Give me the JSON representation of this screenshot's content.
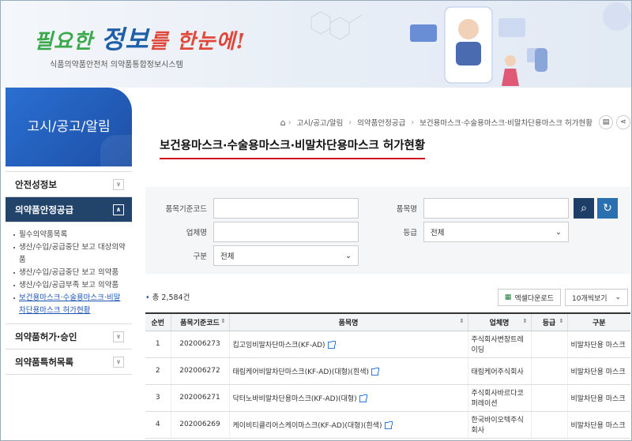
{
  "header": {
    "slogan_part1": "필요한",
    "slogan_part2": "정보",
    "slogan_part3": "를 한눈에!",
    "subtitle": "식품의약품안전처 의약품통합정보시스템"
  },
  "sidebar": {
    "title": "고시/공고/알림",
    "menu": [
      {
        "label": "안전성정보",
        "active": false
      },
      {
        "label": "의약품안정공급",
        "active": true
      },
      {
        "label": "의약품허가·승인",
        "active": false
      },
      {
        "label": "의약품특허목록",
        "active": false
      }
    ],
    "submenu": [
      "필수의약품목록",
      "생산/수입/공급중단 보고 대상의약품",
      "생산/수입/공급중단 보고 의약품",
      "생산/수입/공급부족 보고 의약품",
      "보건용마스크·수술용마스크·비말차단용마스크 허가현황"
    ]
  },
  "breadcrumb": [
    "고시/공고/알림",
    "의약품안정공급",
    "보건용마스크·수술용마스크·비말차단용마스크 허가현황"
  ],
  "page_title": "보건용마스크·수술용마스크·비말차단용마스크 허가현황",
  "search": {
    "code_label": "품목기준코드",
    "name_label": "품목명",
    "company_label": "업체명",
    "grade_label": "등급",
    "grade_value": "전체",
    "type_label": "구분",
    "type_value": "전체"
  },
  "result": {
    "count_text": "총 2,584건",
    "excel_label": "엑셀다운로드",
    "page_size": "10개씩보기"
  },
  "table": {
    "headers": [
      "순번",
      "품목기준코드",
      "품목명",
      "업체명",
      "등급",
      "구분"
    ],
    "rows": [
      [
        "1",
        "202006273",
        "킵고잉비말차단마스크(KF-AD)",
        "주식회사변창트레이딩",
        "",
        "비말차단용 마스크"
      ],
      [
        "2",
        "202006272",
        "태림케어비말차단마스크(KF-AD)(대형)(흰색)",
        "태림케어주식회사",
        "",
        "비말차단용 마스크"
      ],
      [
        "3",
        "202006271",
        "닥터노바비말차단용마스크(KF-AD)(대형)",
        "주식회사바르다코퍼레이션",
        "",
        "비말차단용 마스크"
      ],
      [
        "4",
        "202006269",
        "케이비티클리어스케이마스크(KF-AD)(대형)(흰색)",
        "한국바이오텍주식회사",
        "",
        "비말차단용 마스크"
      ]
    ]
  },
  "colors": {
    "accent_red": "#d0121b",
    "nav_dark": "#22436a",
    "brand_blue": "#1d55b6"
  }
}
